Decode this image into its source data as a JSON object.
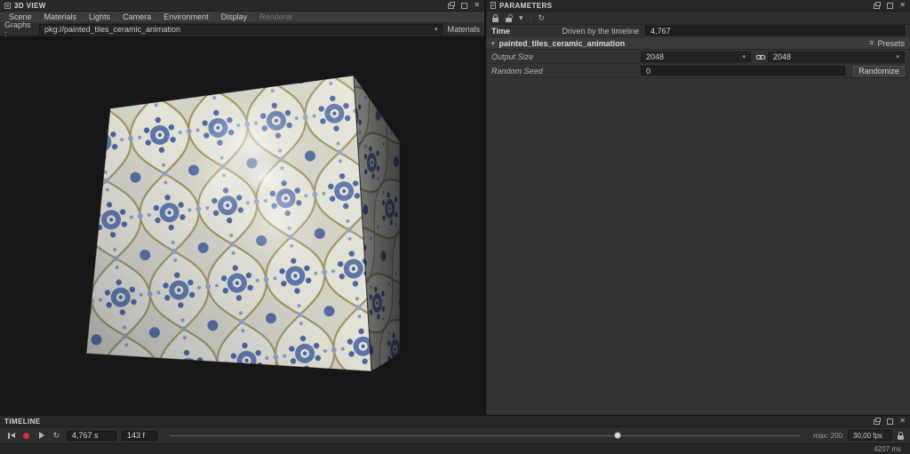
{
  "colors": {
    "accent-red": "#cc3344",
    "tile-bg": "#d7d5c6",
    "tile-ogee": "#e7e5d8",
    "tile-gold": "#a3945e",
    "tile-blue": "#5a74a8",
    "tile-blue-dark": "#46639e"
  },
  "view3d": {
    "title": "3D VIEW",
    "menu": [
      {
        "label": "Scene"
      },
      {
        "label": "Materials"
      },
      {
        "label": "Lights"
      },
      {
        "label": "Camera"
      },
      {
        "label": "Environment"
      },
      {
        "label": "Display"
      },
      {
        "label": "Renderer"
      }
    ],
    "graphs_label": "Graphs :",
    "graphs_value": "pkg://painted_tiles_ceramic_animation",
    "materials_label": "Materials"
  },
  "parameters": {
    "title": "PARAMETERS",
    "time_label": "Time",
    "time_mode_label": "Driven by the timeline",
    "time_value": "4,767",
    "graph_section": "painted_tiles_ceramic_animation",
    "presets_label": "Presets",
    "output_size_label": "Output Size",
    "output_width": "2048",
    "output_height": "2048",
    "random_seed_label": "Random Seed",
    "random_seed_value": "0",
    "randomize_label": "Randomize"
  },
  "timeline": {
    "title": "TIMELINE",
    "time_value": "4,767 s",
    "frame_value": "143 f",
    "max_label": "max: 200",
    "fps_value": "30,00 fps",
    "slider_percent": 71
  },
  "status": {
    "render_ms": "4207 ms"
  },
  "icons": {
    "close": "✕",
    "caret": "▾",
    "refresh": "↻",
    "presets": "≡"
  }
}
